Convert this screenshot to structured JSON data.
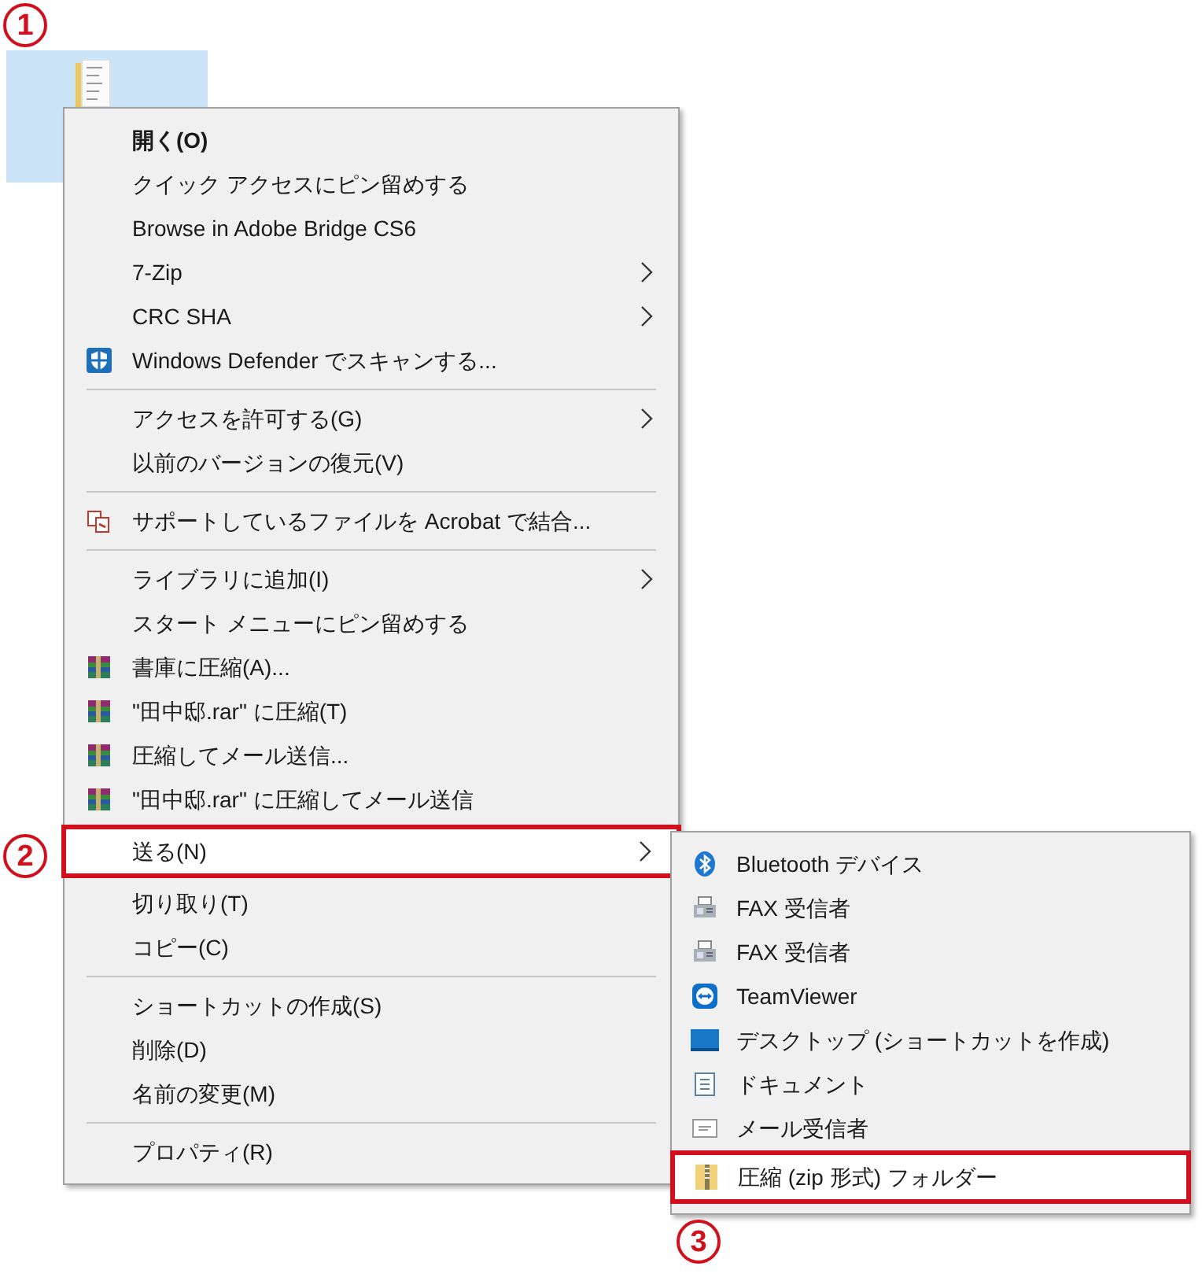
{
  "file_icon": {
    "selected": true
  },
  "context_menu": {
    "items": [
      {
        "kind": "plain",
        "label": "開く(O)",
        "bold": true,
        "selected": false
      },
      {
        "kind": "plain",
        "label": "クイック アクセスにピン留めする",
        "selected": false
      },
      {
        "kind": "plain",
        "label": "Browse in Adobe Bridge CS6",
        "selected": false
      },
      {
        "kind": "plain",
        "label": "7-Zip",
        "submenu": true,
        "selected": false
      },
      {
        "kind": "plain",
        "label": "CRC SHA",
        "submenu": true,
        "selected": false
      },
      {
        "kind": "shield",
        "label": "Windows Defender でスキャンする...",
        "selected": false
      },
      {
        "kind": "separator"
      },
      {
        "kind": "plain",
        "label": "アクセスを許可する(G)",
        "submenu": true,
        "selected": false
      },
      {
        "kind": "plain",
        "label": "以前のバージョンの復元(V)",
        "selected": false
      },
      {
        "kind": "separator"
      },
      {
        "kind": "acrobat",
        "label": "サポートしているファイルを Acrobat で結合...",
        "selected": false
      },
      {
        "kind": "separator"
      },
      {
        "kind": "plain",
        "label": "ライブラリに追加(I)",
        "submenu": true,
        "selected": false
      },
      {
        "kind": "plain",
        "label": "スタート メニューにピン留めする",
        "selected": false
      },
      {
        "kind": "archive",
        "label": "書庫に圧縮(A)...",
        "selected": false
      },
      {
        "kind": "archive",
        "label": "\"田中邸.rar\" に圧縮(T)",
        "selected": false
      },
      {
        "kind": "archive",
        "label": "圧縮してメール送信...",
        "selected": false
      },
      {
        "kind": "archive",
        "label": "\"田中邸.rar\" に圧縮してメール送信",
        "selected": false
      },
      {
        "kind": "plain",
        "label": "送る(N)",
        "submenu": true,
        "selected": true
      },
      {
        "kind": "plain",
        "label": "切り取り(T)",
        "selected": false
      },
      {
        "kind": "plain",
        "label": "コピー(C)",
        "selected": false
      },
      {
        "kind": "separator"
      },
      {
        "kind": "plain",
        "label": "ショートカットの作成(S)",
        "selected": false
      },
      {
        "kind": "plain",
        "label": "削除(D)",
        "selected": false
      },
      {
        "kind": "plain",
        "label": "名前の変更(M)",
        "selected": false
      },
      {
        "kind": "separator"
      },
      {
        "kind": "plain",
        "label": "プロパティ(R)",
        "selected": false
      }
    ]
  },
  "send_to_menu": {
    "items": [
      {
        "label": "Bluetooth デバイス",
        "kind": "bluetooth",
        "selected": false
      },
      {
        "label": "FAX 受信者",
        "kind": "fax",
        "selected": false
      },
      {
        "label": "FAX 受信者",
        "kind": "fax",
        "selected": false
      },
      {
        "label": "TeamViewer",
        "kind": "teamviewer",
        "selected": false
      },
      {
        "label": "デスクトップ (ショートカットを作成)",
        "kind": "desktop",
        "selected": false
      },
      {
        "label": "ドキュメント",
        "kind": "document",
        "selected": false
      },
      {
        "label": "メール受信者",
        "kind": "mail",
        "selected": false
      },
      {
        "label": "圧縮 (zip 形式) フォルダー",
        "kind": "zip",
        "selected": true
      }
    ]
  },
  "callouts": [
    "1",
    "2",
    "3"
  ]
}
